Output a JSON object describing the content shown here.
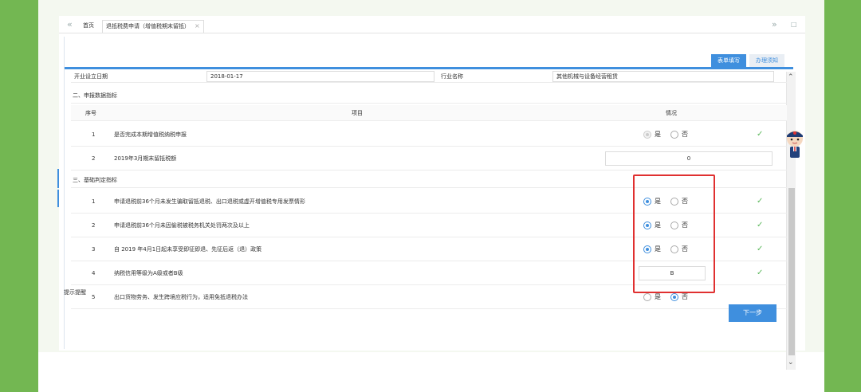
{
  "tabs": {
    "prev": "«",
    "next": "»",
    "restore": "□",
    "home": "首页",
    "current": "退抵税费申请（增值税期末留抵）",
    "close": "×"
  },
  "buttons": {
    "form_fill": "表单填写",
    "guide": "办理须知",
    "next_step": "下一步"
  },
  "basic": {
    "start_date_label": "开业设立日期",
    "start_date_value": "2018-01-17",
    "industry_label": "行业名称",
    "industry_value": "其他机械与设备经营租赁"
  },
  "section2": {
    "title": "二、申报数据指标",
    "headers": {
      "no": "序号",
      "item": "项目",
      "status": "情况"
    },
    "rows": [
      {
        "no": "1",
        "item": "是否完成本期增值税纳税申报",
        "yes": "是",
        "no_label": "否",
        "check": "✓"
      },
      {
        "no": "2",
        "item": "2019年3月期末留抵税额",
        "value": "0"
      }
    ]
  },
  "section3": {
    "title": "三、基础判定指标",
    "rows": [
      {
        "no": "1",
        "item": "申请退税前36个月未发生骗取留抵退税、出口退税或虚开增值税专用发票情形",
        "yes": "是",
        "no_label": "否",
        "check": "✓"
      },
      {
        "no": "2",
        "item": "申请退税前36个月未因偷税被税务机关处罚两次及以上",
        "yes": "是",
        "no_label": "否",
        "check": "✓"
      },
      {
        "no": "3",
        "item": "自 2019 年4月1日起未享受即征即退、先征后返（退）政策",
        "yes": "是",
        "no_label": "否",
        "check": "✓"
      },
      {
        "no": "4",
        "item": "纳税信用等级为A级或者B级",
        "value": "B",
        "check": "✓"
      },
      {
        "no": "5",
        "item": "出口货物劳务、发生跨境应税行为，适用免抵退税办法",
        "yes": "是",
        "no_label": "否"
      }
    ]
  },
  "hint": "提示提醒",
  "scroll": {
    "up": "⌃",
    "down": "⌄"
  }
}
